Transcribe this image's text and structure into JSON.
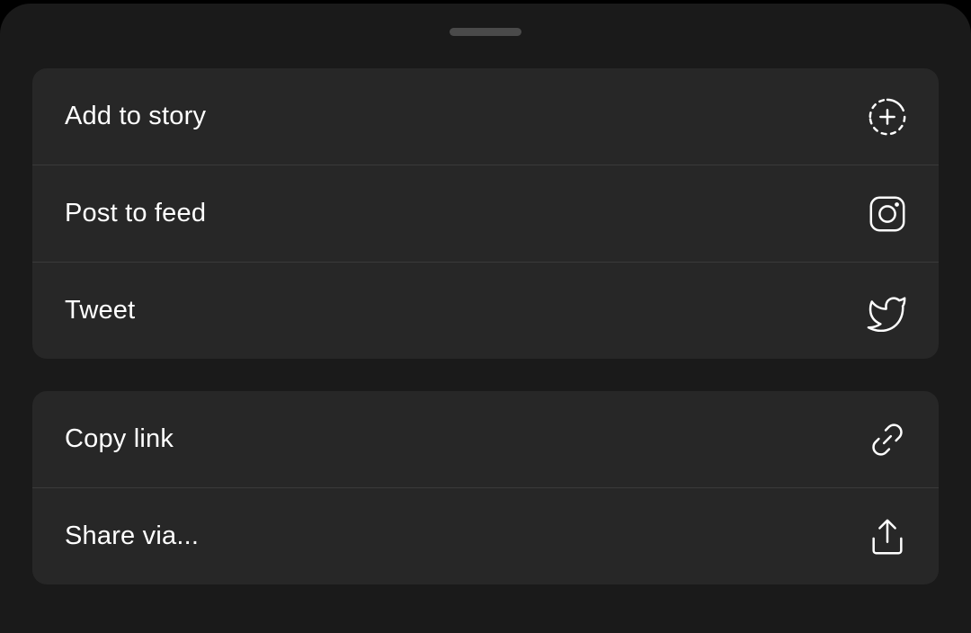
{
  "share_sheet": {
    "groups": [
      {
        "items": [
          {
            "label": "Add to story",
            "icon": "add-story-icon"
          },
          {
            "label": "Post to feed",
            "icon": "instagram-icon"
          },
          {
            "label": "Tweet",
            "icon": "twitter-icon"
          }
        ]
      },
      {
        "items": [
          {
            "label": "Copy link",
            "icon": "link-icon"
          },
          {
            "label": "Share via...",
            "icon": "share-icon"
          }
        ]
      }
    ]
  },
  "colors": {
    "background": "#1a1a1a",
    "card": "#272727",
    "divider": "#3a3a3a",
    "text": "#ffffff",
    "grabber": "#4a4a4a"
  }
}
